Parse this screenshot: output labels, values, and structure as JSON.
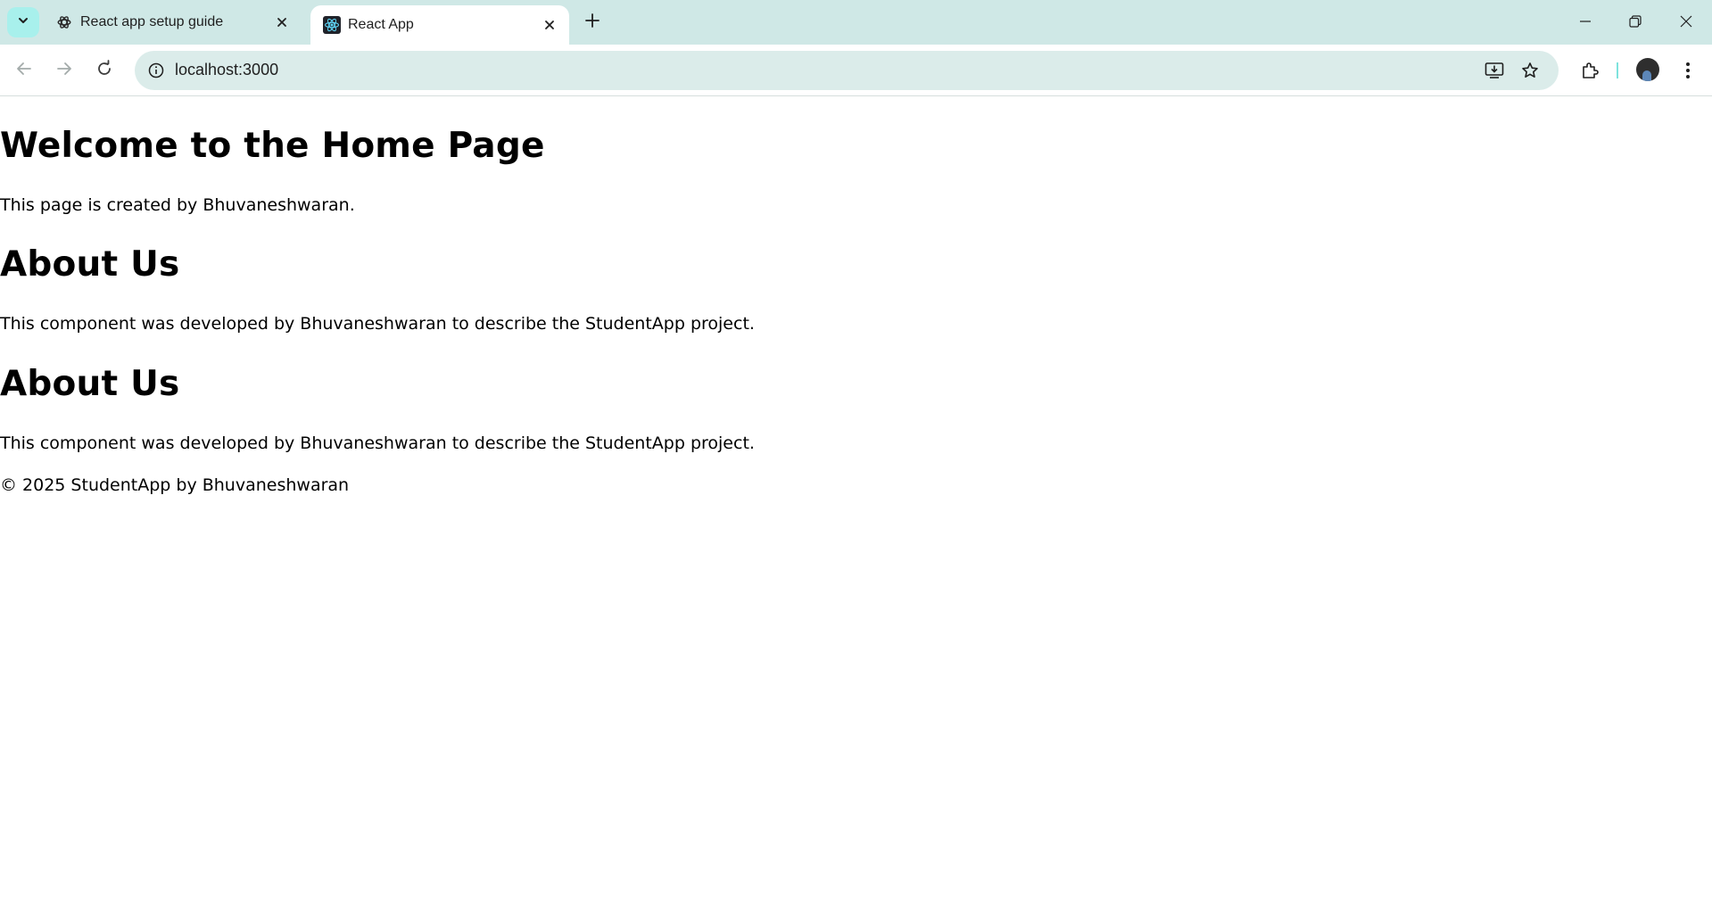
{
  "browser": {
    "tabs": [
      {
        "title": "React app setup guide",
        "favicon": "chatgpt-icon",
        "active": false
      },
      {
        "title": "React App",
        "favicon": "react-icon",
        "active": true
      }
    ],
    "address_bar": {
      "url": "localhost:3000"
    }
  },
  "page": {
    "home_title": "Welcome to the Home Page",
    "home_text": "This page is created by Bhuvaneshwaran.",
    "about_sections": [
      {
        "title": "About Us",
        "text": "This component was developed by Bhuvaneshwaran to describe the StudentApp project."
      },
      {
        "title": "About Us",
        "text": "This component was developed by Bhuvaneshwaran to describe the StudentApp project."
      }
    ],
    "footer": "© 2025 StudentApp by Bhuvaneshwaran"
  },
  "colors": {
    "tabstrip_bg": "#cfe8e6",
    "omnibox_bg": "#dbecea",
    "accent": "#a8f0ec"
  }
}
